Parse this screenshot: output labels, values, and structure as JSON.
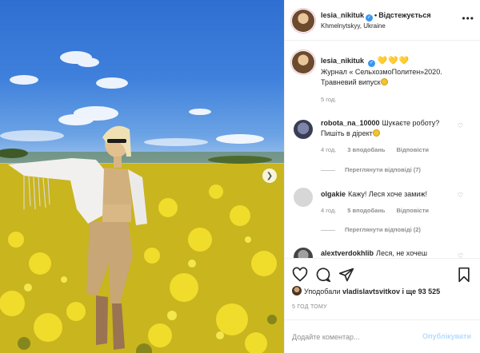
{
  "post": {
    "author": "lesia_nikituk",
    "follow_status": "Відстежується",
    "location": "Khmelnytskyy, Ukraine",
    "caption_user": "lesia_nikituk",
    "caption_hearts": "💛💛💛",
    "caption_text": "Журнал « СельхозмоПолитен»2020. Травневий випуск",
    "caption_time": "5 год.",
    "likes_prefix": "Уподобали",
    "likes_user": "vladislavtsvitkov",
    "likes_suffix": " і ще 93 525",
    "time_ago": "5 ГОД ТОМУ"
  },
  "comments": [
    {
      "user": "robota_na_10000",
      "text": "Шукаєте роботу? Пишіть в дірект",
      "time": "4 год.",
      "likes": "3 вподобань",
      "reply": "Відповісти",
      "view_replies": "Переглянути відповіді (7)"
    },
    {
      "user": "olgakie",
      "text": "Кажу! Леся хоче замиж!",
      "time": "4 год.",
      "likes": "5 вподобань",
      "reply": "Відповісти",
      "view_replies": "Переглянути відповіді (2)"
    },
    {
      "user": "alextverdokhlib",
      "text": "Леся, не хочеш",
      "time": "",
      "likes": "",
      "reply": "",
      "view_replies": ""
    }
  ],
  "composer": {
    "placeholder": "Додайте коментар...",
    "post_label": "Опублікувати"
  },
  "icons": [
    "heart-icon",
    "comment-icon",
    "share-icon",
    "bookmark-icon",
    "more-icon",
    "verified-icon",
    "chevron-right-icon"
  ],
  "colors": {
    "accent": "#3897f0",
    "post_disabled": "#b3dbff",
    "muted": "#8e8e8e",
    "text": "#262626"
  }
}
